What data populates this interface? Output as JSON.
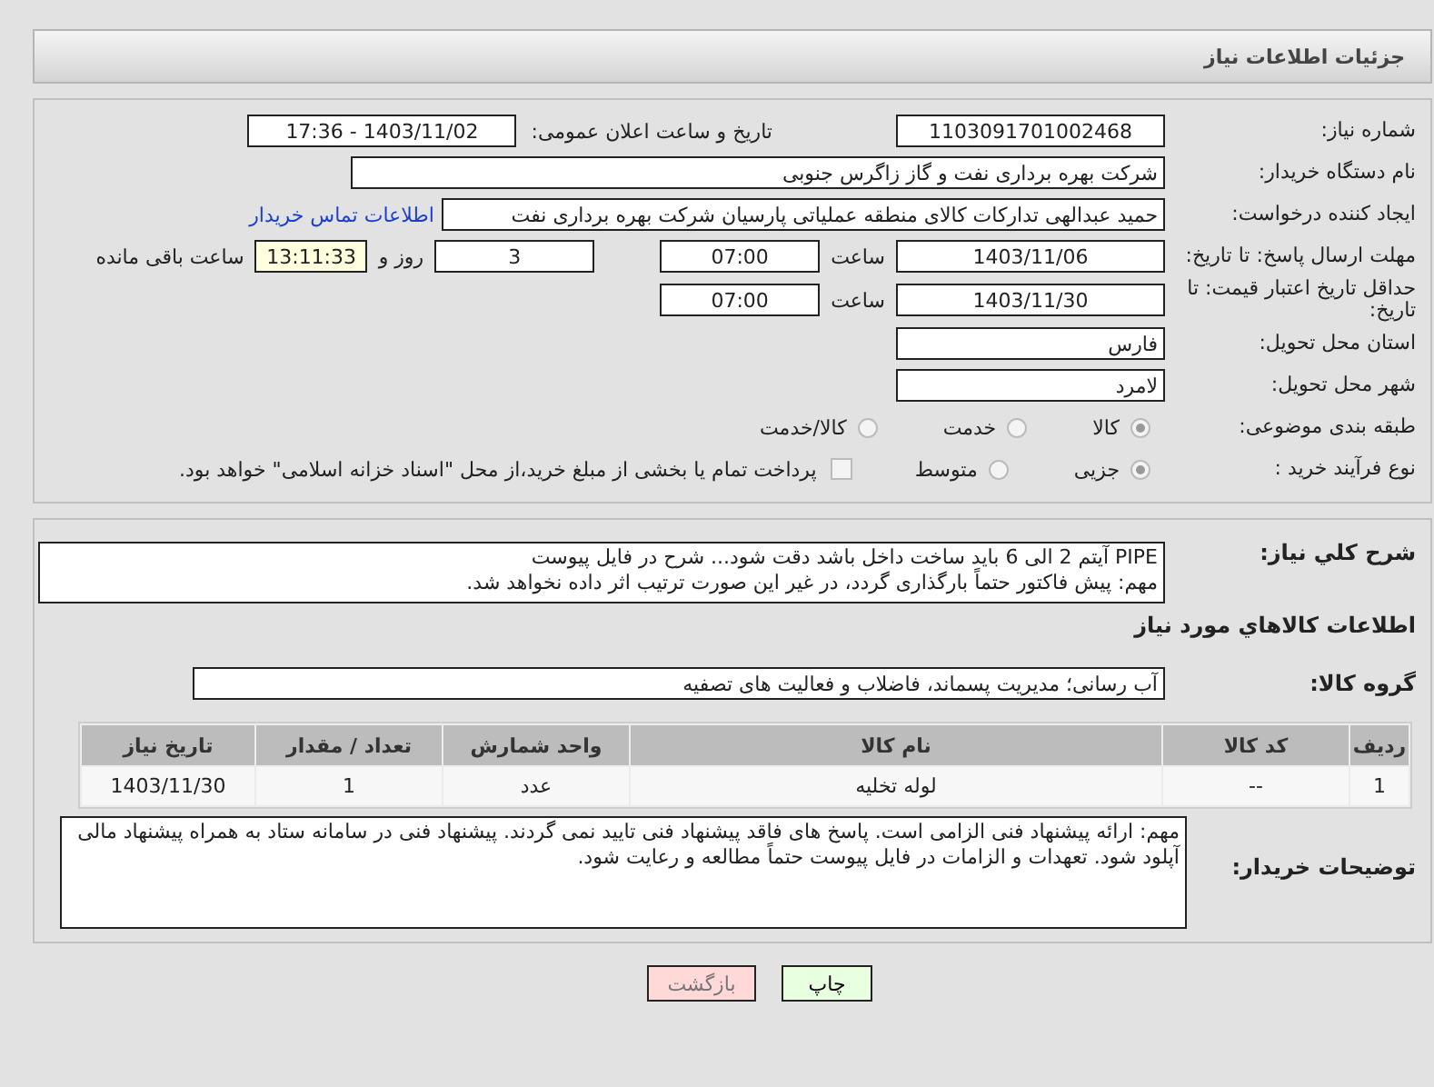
{
  "header": {
    "title": "جزئیات اطلاعات نیاز"
  },
  "info": {
    "need_number": {
      "label": "شماره نیاز:",
      "value": "1103091701002468"
    },
    "announce": {
      "label": "تاریخ و ساعت اعلان عمومی:",
      "value": "1403/11/02 - 17:36"
    },
    "buyer": {
      "label": "نام دستگاه خریدار:",
      "value": "شرکت بهره برداری نفت و گاز زاگرس جنوبی"
    },
    "requester": {
      "label": "ایجاد کننده درخواست:",
      "value": "حمید عبدالهی تدارکات کالای منطقه عملیاتی پارسیان شرکت بهره برداری نفت",
      "link": "اطلاعات تماس خریدار"
    },
    "deadline": {
      "label": "مهلت ارسال پاسخ: تا تاریخ:",
      "date": "1403/11/06",
      "time_label": "ساعت",
      "time": "07:00",
      "days": "3",
      "days_label": "روز و",
      "remaining": "13:11:33",
      "remaining_label": "ساعت باقی مانده"
    },
    "validity": {
      "label": "حداقل تاریخ اعتبار قیمت: تا تاریخ:",
      "date": "1403/11/30",
      "time_label": "ساعت",
      "time": "07:00"
    },
    "province": {
      "label": "استان محل تحویل:",
      "value": "فارس"
    },
    "city": {
      "label": "شهر محل تحویل:",
      "value": "لامرد"
    },
    "category": {
      "label": "طبقه بندی موضوعی:",
      "options": [
        {
          "label": "کالا",
          "selected": true
        },
        {
          "label": "خدمت",
          "selected": false
        },
        {
          "label": "کالا/خدمت",
          "selected": false
        }
      ]
    },
    "process": {
      "label": "نوع فرآیند خرید :",
      "options": [
        {
          "label": "جزیی",
          "selected": true
        },
        {
          "label": "متوسط",
          "selected": false
        }
      ],
      "treasury": {
        "label": "پرداخت تمام یا بخشی از مبلغ خرید،از محل \"اسناد خزانه اسلامی\" خواهد بود.",
        "checked": false
      }
    }
  },
  "details": {
    "description": {
      "label": "شرح کلي نياز:",
      "lines": [
        "PIPE  آیتم 2 الی 6 باید ساخت داخل باشد دقت شود... شرح در فایل پیوست",
        "مهم: پیش فاکتور حتماً بارگذاری گردد، در غیر این صورت ترتیب اثر داده نخواهد شد."
      ]
    },
    "goods_heading": "اطلاعات کالاهاي مورد نياز",
    "group": {
      "label": "گروه کالا:",
      "value": "آب رسانی؛ مدیریت پسماند، فاضلاب و فعالیت های تصفیه"
    },
    "table": {
      "columns": [
        "ردیف",
        "کد کالا",
        "نام کالا",
        "واحد شمارش",
        "تعداد / مقدار",
        "تاریخ نیاز"
      ],
      "rows": [
        [
          "1",
          "--",
          "لوله تخلیه",
          "عدد",
          "1",
          "1403/11/30"
        ]
      ]
    },
    "notes": {
      "label": "توضیحات خریدار:",
      "text": "مهم: ارائه پیشنهاد فنی الزامی است. پاسخ های فاقد پیشنهاد فنی تایید نمی گردند.  پیشنهاد فنی در سامانه ستاد به همراه پیشنهاد مالی آپلود شود. تعهدات و الزامات در فایل پیوست حتماً مطالعه و رعایت شود."
    }
  },
  "buttons": [
    {
      "label": "چاپ",
      "kind": "print"
    },
    {
      "label": "بازگشت",
      "kind": "back"
    }
  ]
}
